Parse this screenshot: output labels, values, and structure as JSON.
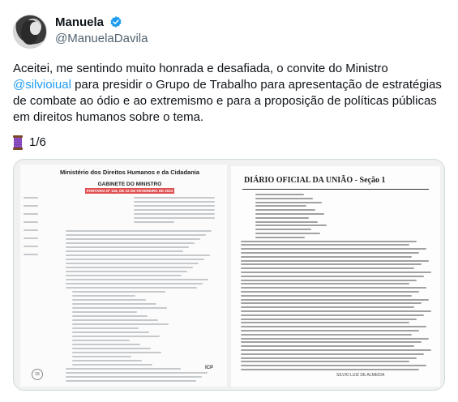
{
  "user": {
    "display_name": "Manuela",
    "handle": "@ManuelaDavila",
    "verified": true,
    "avatar_icon": "avatar-photo"
  },
  "tweet": {
    "text_before_mention": "Aceitei, me sentindo muito honrada e desafiada, o convite do Ministro ",
    "mention": "@silvioiual",
    "text_after_mention": " para presidir o Grupo de Trabalho para apresentação de estratégias de combate ao ódio e ao extremismo e para a proposição de políticas públicas em direitos humanos sobre o tema.",
    "thread_icon": "spool-of-thread-icon",
    "thread_counter": "1/6"
  },
  "media": {
    "left_page": {
      "header": "Ministério dos Direitos Humanos e da Cidadania",
      "office": "GABINETE DO MINISTRO",
      "portaria": "PORTARIA Nº 126, DE 22 DE FEVEREIRO DE 2023",
      "page_number": "15",
      "footer_mark": "ICP"
    },
    "right_page": {
      "header": "DIÁRIO OFICIAL DA UNIÃO - Seção 1",
      "signature": "SILVIO LUIZ DE ALMEIDA"
    }
  },
  "colors": {
    "text": "#0f1419",
    "secondary": "#536471",
    "link": "#1d9bf0",
    "verified": "#1d9bf0",
    "border": "#cfd9de",
    "portaria_highlight": "#e05050"
  }
}
